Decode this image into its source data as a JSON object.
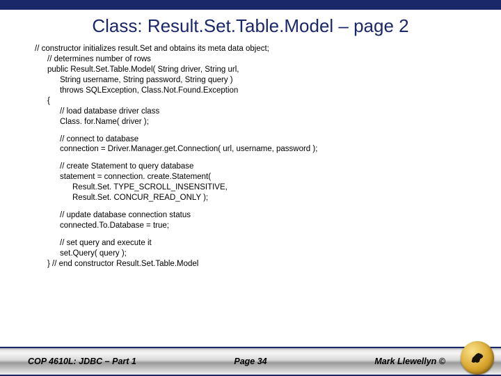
{
  "title": "Class:  Result.Set.Table.Model – page 2",
  "code": {
    "c01": "// constructor initializes result.Set and obtains its meta data object;",
    "c02": "// determines number of rows",
    "c03": "public Result.Set.Table.Model( String driver, String url,",
    "c04": "String username, String password, String query )",
    "c05": "throws SQLException, Class.Not.Found.Exception",
    "c06": "{",
    "c07": "// load database driver class",
    "c08": "Class. for.Name( driver );",
    "c09": "// connect to database",
    "c10": "connection = Driver.Manager.get.Connection( url, username, password );",
    "c11": "// create Statement to query database",
    "c12": "statement = connection. create.Statement(",
    "c13": "Result.Set. TYPE_SCROLL_INSENSITIVE,",
    "c14": "Result.Set. CONCUR_READ_ONLY );",
    "c15": "// update database connection status",
    "c16": "connected.To.Database = true;",
    "c17": "// set query and execute it",
    "c18": "set.Query( query );",
    "c19": "} // end constructor Result.Set.Table.Model"
  },
  "footer": {
    "left": "COP 4610L: JDBC – Part 1",
    "center": "Page 34",
    "right": "Mark Llewellyn ©"
  }
}
